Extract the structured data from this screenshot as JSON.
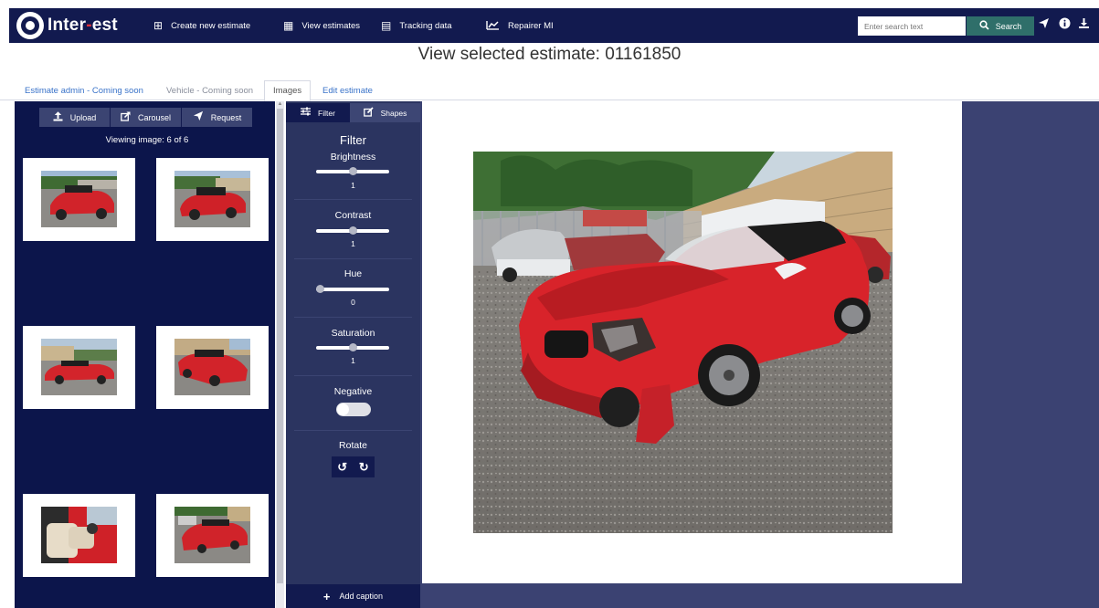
{
  "app": {
    "logo_prefix": "Inter",
    "logo_dash": "-",
    "logo_suffix": "est"
  },
  "nav": {
    "items": [
      {
        "label": "Create new estimate",
        "icon": "plus-square-icon"
      },
      {
        "label": "View estimates",
        "icon": "table-icon"
      },
      {
        "label": "Tracking data",
        "icon": "calendar-icon"
      },
      {
        "label": "Repairer MI",
        "icon": "chart-line-icon"
      }
    ],
    "search_placeholder": "Enter search text",
    "search_label": "Search",
    "right_icons": [
      "send-icon",
      "info-icon",
      "download-icon"
    ]
  },
  "page": {
    "title": "View selected estimate: 01161850"
  },
  "tabs": [
    {
      "label": "Estimate admin - Coming soon",
      "state": "link"
    },
    {
      "label": "Vehicle - Coming soon",
      "state": "muted"
    },
    {
      "label": "Images",
      "state": "active"
    },
    {
      "label": "Edit estimate",
      "state": "link"
    }
  ],
  "gallery": {
    "toolbar": {
      "upload": "Upload",
      "carousel": "Carousel",
      "request": "Request"
    },
    "viewing_text": "Viewing image: 6 of 6",
    "image_count": 6
  },
  "editor": {
    "tabs": {
      "filter": "Filter",
      "shapes": "Shapes"
    },
    "heading": "Filter",
    "controls": {
      "brightness": {
        "label": "Brightness",
        "value": "1",
        "level": 0.5
      },
      "contrast": {
        "label": "Contrast",
        "value": "1",
        "level": 0.5
      },
      "hue": {
        "label": "Hue",
        "value": "0",
        "level": 0.0
      },
      "saturation": {
        "label": "Saturation",
        "value": "1",
        "level": 0.5
      }
    },
    "negative_label": "Negative",
    "negative_on": false,
    "rotate_label": "Rotate",
    "add_caption": "Add caption"
  },
  "colors": {
    "navbar": "#121a4f",
    "panel": "#0c154b",
    "editor_panel": "#2b3460",
    "search_button": "#2f6f6a",
    "link": "#3a73c9",
    "car_red": "#d8232a"
  }
}
